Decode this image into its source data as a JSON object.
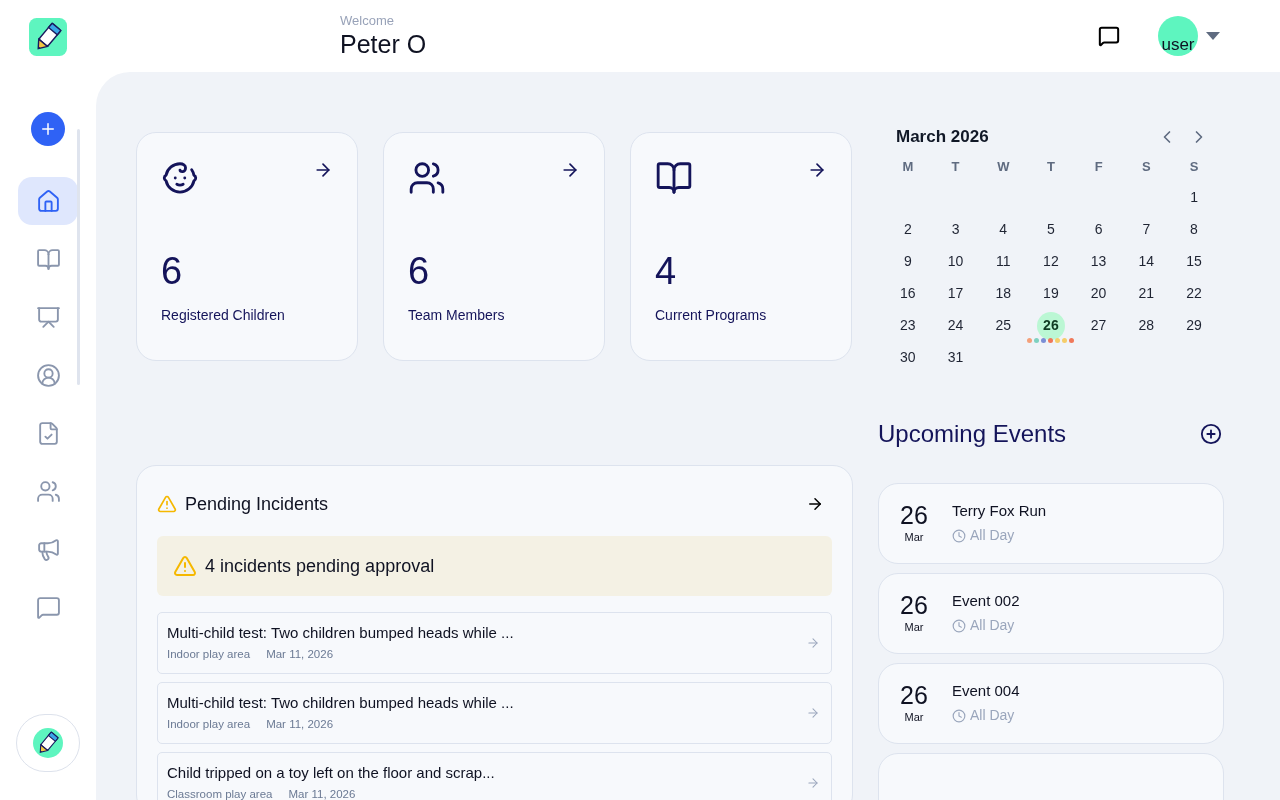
{
  "header": {
    "greeting": "Welcome",
    "user_name": "Peter O",
    "avatar_text": "user"
  },
  "sidebar": {
    "items": [
      {
        "kind": "home",
        "selected": true
      },
      {
        "kind": "book",
        "selected": false
      },
      {
        "kind": "presentation",
        "selected": false
      },
      {
        "kind": "profile",
        "selected": false
      },
      {
        "kind": "checklist",
        "selected": false
      },
      {
        "kind": "people",
        "selected": false
      },
      {
        "kind": "megaphone",
        "selected": false
      },
      {
        "kind": "message",
        "selected": false
      }
    ]
  },
  "stats": [
    {
      "kind": "children",
      "value": "6",
      "label": "Registered Children"
    },
    {
      "kind": "team",
      "value": "6",
      "label": "Team Members"
    },
    {
      "kind": "programs",
      "value": "4",
      "label": "Current Programs"
    }
  ],
  "incidents": {
    "title": "Pending Incidents",
    "alert": "4 incidents pending approval",
    "items": [
      {
        "title": "Multi-child test: Two children bumped heads while ...",
        "location": "Indoor play area",
        "date": "Mar 11, 2026"
      },
      {
        "title": "Multi-child test: Two children bumped heads while ...",
        "location": "Indoor play area",
        "date": "Mar 11, 2026"
      },
      {
        "title": "Child tripped on a toy left on the floor and scrap...",
        "location": "Classroom play area",
        "date": "Mar 11, 2026"
      }
    ]
  },
  "calendar": {
    "title": "March 2026",
    "weekdays": [
      "M",
      "T",
      "W",
      "T",
      "F",
      "S",
      "S"
    ],
    "weeks": [
      {
        "kind": "end-aligned",
        "days": [
          {
            "day": "1",
            "selected": false
          }
        ]
      },
      {
        "kind": "start-aligned",
        "days": [
          {
            "day": "2",
            "selected": false
          },
          {
            "day": "3",
            "selected": false
          },
          {
            "day": "4",
            "selected": false
          },
          {
            "day": "5",
            "selected": false
          },
          {
            "day": "6",
            "selected": false
          },
          {
            "day": "7",
            "selected": false
          },
          {
            "day": "8",
            "selected": false
          }
        ]
      },
      {
        "kind": "start-aligned",
        "days": [
          {
            "day": "9",
            "selected": false
          },
          {
            "day": "10",
            "selected": false
          },
          {
            "day": "11",
            "selected": false
          },
          {
            "day": "12",
            "selected": false
          },
          {
            "day": "13",
            "selected": false
          },
          {
            "day": "14",
            "selected": false
          },
          {
            "day": "15",
            "selected": false
          }
        ]
      },
      {
        "kind": "start-aligned",
        "days": [
          {
            "day": "16",
            "selected": false
          },
          {
            "day": "17",
            "selected": false
          },
          {
            "day": "18",
            "selected": false
          },
          {
            "day": "19",
            "selected": false
          },
          {
            "day": "20",
            "selected": false
          },
          {
            "day": "21",
            "selected": false
          },
          {
            "day": "22",
            "selected": false
          }
        ]
      },
      {
        "kind": "start-aligned",
        "days": [
          {
            "day": "23",
            "selected": false
          },
          {
            "day": "24",
            "selected": false
          },
          {
            "day": "25",
            "selected": false
          },
          {
            "day": "26",
            "selected": true,
            "events": [
              {
                "color": "#f4a07a"
              },
              {
                "color": "#7fd1c0"
              },
              {
                "color": "#7b8ed6"
              },
              {
                "color": "#f0785a"
              },
              {
                "color": "#f5cd6a"
              },
              {
                "color": "#f5cd6a"
              },
              {
                "color": "#f0785a"
              }
            ]
          },
          {
            "day": "27",
            "selected": false
          },
          {
            "day": "28",
            "selected": false
          },
          {
            "day": "29",
            "selected": false
          }
        ]
      },
      {
        "kind": "start-aligned",
        "days": [
          {
            "day": "30",
            "selected": false
          },
          {
            "day": "31",
            "selected": false
          }
        ]
      }
    ]
  },
  "events": {
    "title": "Upcoming Events",
    "items": [
      {
        "day": "26",
        "month": "Mar",
        "title": "Terry Fox Run",
        "time": "All Day"
      },
      {
        "day": "26",
        "month": "Mar",
        "title": "Event 002",
        "time": "All Day"
      },
      {
        "day": "26",
        "month": "Mar",
        "title": "Event 004",
        "time": "All Day"
      },
      {
        "kind": "empty"
      }
    ]
  }
}
